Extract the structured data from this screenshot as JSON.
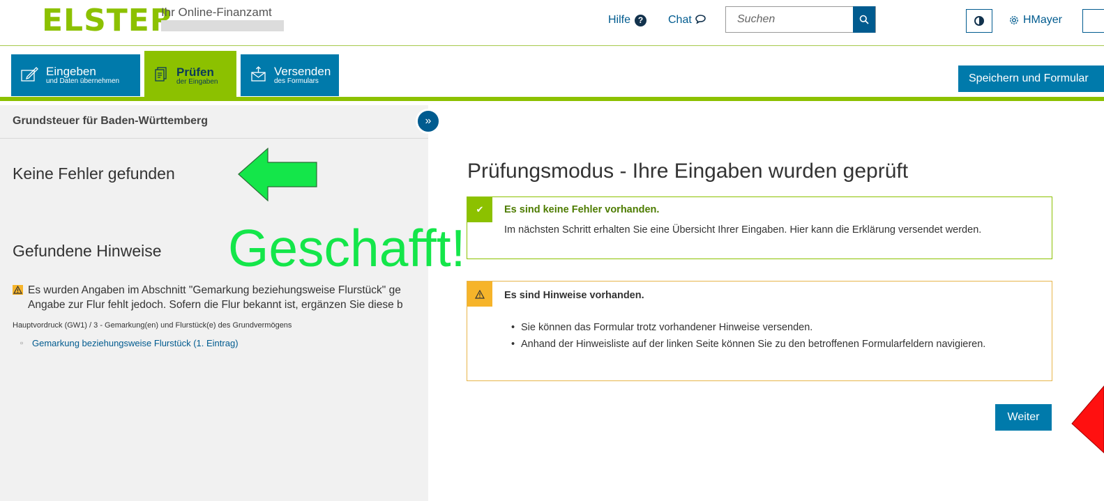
{
  "header": {
    "logo": "ELSTER",
    "tagline": "Ihr Online-Finanzamt",
    "help_label": "Hilfe",
    "chat_label": "Chat",
    "search_placeholder": "Suchen",
    "user_name": "HMayer"
  },
  "toolbar": {
    "steps": [
      {
        "title": "Eingeben",
        "subtitle": "und Daten übernehmen",
        "icon": "edit-form-icon",
        "active": false
      },
      {
        "title": "Prüfen",
        "subtitle": "der Eingaben",
        "icon": "check-document-icon",
        "active": true
      },
      {
        "title": "Versenden",
        "subtitle": "des Formulars",
        "icon": "send-envelope-icon",
        "active": false
      }
    ],
    "save_label": "Speichern und Formular"
  },
  "sidebar": {
    "form_title": "Grundsteuer für Baden-Württemberg",
    "no_errors_heading": "Keine Fehler gefunden",
    "hints_heading": "Gefundene Hinweise",
    "hint_text_line1": "Es wurden Angaben im Abschnitt \"Gemarkung beziehungsweise Flurstück\" ge",
    "hint_text_line2": "Angabe zur Flur fehlt jedoch. Sofern die Flur bekannt ist, ergänzen Sie diese b",
    "hint_path": "Hauptvordruck (GW1) / 3 - Gemarkung(en) und Flurstück(e) des Grundvermögens",
    "hint_link": "Gemarkung beziehungsweise Flurstück (1. Eintrag)"
  },
  "annotations": {
    "geschafft": "Geschafft!",
    "green_arrow_color": "#14e64a",
    "red_arrow_color": "#ff1010"
  },
  "main": {
    "title": "Prüfungsmodus - Ihre Eingaben wurden geprüft",
    "ok_box": {
      "title": "Es sind keine Fehler vorhanden.",
      "text": "Im nächsten Schritt erhalten Sie eine Übersicht Ihrer Eingaben. Hier kann die Erklärung versendet werden."
    },
    "warn_box": {
      "title": "Es sind Hinweise vorhanden.",
      "items": [
        "Sie können das Formular trotz vorhandener Hinweise versenden.",
        "Anhand der Hinweisliste auf der linken Seite können Sie zu den betroffenen Formularfeldern navigieren."
      ]
    },
    "next_label": "Weiter"
  },
  "colors": {
    "brand_green": "#8cc100",
    "brand_blue": "#007aab",
    "warning": "#f6b42a"
  }
}
